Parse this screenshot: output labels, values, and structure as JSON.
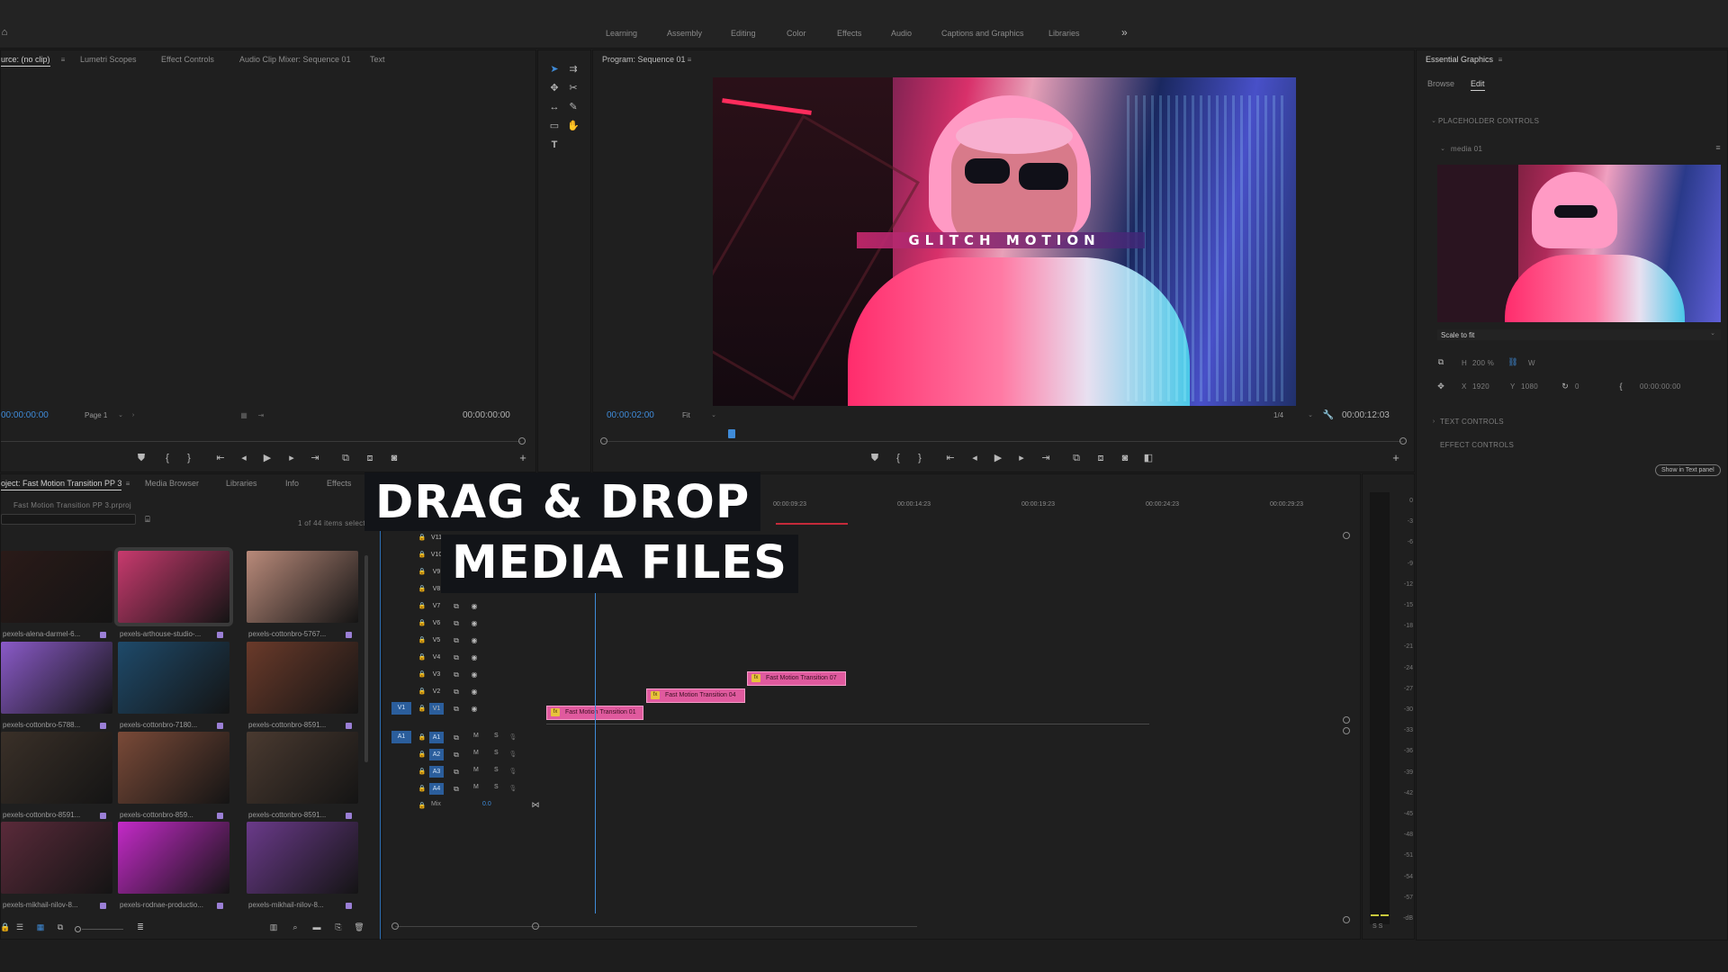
{
  "workspaces": [
    "Learning",
    "Assembly",
    "Editing",
    "Color",
    "Effects",
    "Audio",
    "Captions and Graphics",
    "Libraries"
  ],
  "workspaces_more": "»",
  "source_panel": {
    "tabs": [
      "urce: (no clip)",
      "Lumetri Scopes",
      "Effect Controls",
      "Audio Clip Mixer: Sequence 01",
      "Text"
    ],
    "timecode_left": "00:00:00:00",
    "page": "Page 1",
    "timecode_right": "00:00:00:00"
  },
  "program_panel": {
    "title": "Program: Sequence 01",
    "timecode": "00:00:02:00",
    "fit": "Fit",
    "resolution": "1/4",
    "duration": "00:00:12:03",
    "video_title": "GLITCH MOTION",
    "playhead_fraction": 0.16
  },
  "project_panel": {
    "tabs": [
      "oject: Fast Motion Transition PP 3",
      "Media Browser",
      "Libraries",
      "Info",
      "Effects"
    ],
    "file": "Fast Motion Transition PP 3.prproj",
    "count": "1 of 44 items selecte",
    "items": [
      {
        "label": "pexels-alena-darmel-6...",
        "color": "#2a1a18"
      },
      {
        "label": "pexels-arthouse-studio-...",
        "color": "#c83a6e"
      },
      {
        "label": "pexels-cottonbro-5767...",
        "color": "#b98a7a"
      },
      {
        "label": "pexels-cottonbro-5788...",
        "color": "#8a5ac8"
      },
      {
        "label": "pexels-cottonbro-7180...",
        "color": "#1e4a6a"
      },
      {
        "label": "pexels-cottonbro-8591...",
        "color": "#6a3a2a"
      },
      {
        "label": "pexels-cottonbro-8591...",
        "color": "#3a3028"
      },
      {
        "label": "pexels-cottonbro-859...",
        "color": "#7a4a38"
      },
      {
        "label": "pexels-cottonbro-8591...",
        "color": "#4a3a30"
      },
      {
        "label": "pexels-mikhail-nilov-8...",
        "color": "#5a2a3a"
      },
      {
        "label": "pexels-rodnae-productio...",
        "color": "#c42ac8"
      },
      {
        "label": "pexels-mikhail-nilov-8...",
        "color": "#6a3a8a"
      }
    ]
  },
  "timeline": {
    "ruler": [
      "00:00:09:23",
      "00:00:14:23",
      "00:00:19:23",
      "00:00:24:23",
      "00:00:29:23"
    ],
    "video_tracks": [
      "V11",
      "V10",
      "V9",
      "V8",
      "V7",
      "V6",
      "V5",
      "V4",
      "V3",
      "V2",
      "V1"
    ],
    "audio_tracks": [
      "A1",
      "A2",
      "A3",
      "A4"
    ],
    "target_v": "V1",
    "target_a": "A1",
    "mix_label": "Mix",
    "mix_value": "0.0",
    "m_label": "M",
    "s_label": "S",
    "clips": [
      {
        "label": "Fast Motion Transition 01"
      },
      {
        "label": "Fast Motion Transition 04"
      },
      {
        "label": "Fast Motion Transition 07"
      }
    ]
  },
  "meter": {
    "labels": [
      "0",
      "-3",
      "-6",
      "-9",
      "-12",
      "-15",
      "-18",
      "-21",
      "-24",
      "-27",
      "-30",
      "-33",
      "-36",
      "-39",
      "-42",
      "-45",
      "-48",
      "-51",
      "-54",
      "-57",
      "-dB"
    ],
    "ss": "S S"
  },
  "overlay": {
    "line1": "DRAG & DROP",
    "line2": "MEDIA FILES"
  },
  "essential_graphics": {
    "title": "Essential Graphics",
    "tabs": [
      "Browse",
      "Edit"
    ],
    "placeholder_controls": "PLACEHOLDER CONTROLS",
    "media": "media 01",
    "scale": "Scale to fit",
    "h_label": "H",
    "h_value": "200 %",
    "w_label": "W",
    "x_label": "X",
    "x_value": "1920",
    "y_label": "Y",
    "y_value": "1080",
    "rot_value": "0",
    "time_value": "00:00:00:00",
    "text_controls": "TEXT CONTROLS",
    "effect_controls": "EFFECT CONTROLS",
    "show_button": "Show in Text panel"
  }
}
